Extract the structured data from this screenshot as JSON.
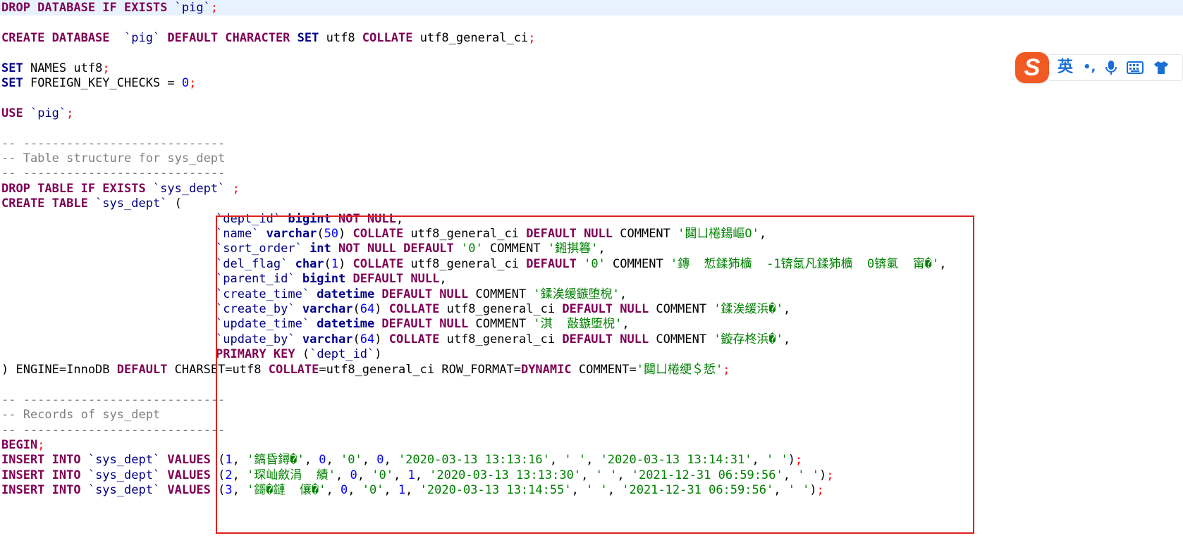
{
  "editor": {
    "lines": [
      {
        "text": "",
        "top": 0,
        "tokens": [
          {
            "t": "DROP DATABASE IF EXISTS ",
            "c": "kw"
          },
          {
            "t": "`pig`",
            "c": "id"
          },
          {
            "t": ";",
            "c": "semi"
          }
        ]
      },
      {
        "tokens": [
          {
            "t": "CREATE DATABASE  ",
            "c": "kw"
          },
          {
            "t": "`pig`",
            "c": "id"
          },
          {
            "t": " DEFAULT CHARACTER ",
            "c": "kw"
          },
          {
            "t": "SET",
            "c": "kw2"
          },
          {
            "t": " utf8 ",
            "c": "plain"
          },
          {
            "t": "COLLATE",
            "c": "kw"
          },
          {
            "t": " utf8_general_ci",
            "c": "plain"
          },
          {
            "t": ";",
            "c": "semi"
          }
        ]
      },
      {
        "tokens": [
          {
            "t": "SET",
            "c": "kw2"
          },
          {
            "t": " NAMES utf8",
            "c": "plain"
          },
          {
            "t": ";",
            "c": "semi"
          }
        ]
      },
      {
        "tokens": [
          {
            "t": "SET",
            "c": "kw2"
          },
          {
            "t": " FOREIGN_KEY_CHECKS = ",
            "c": "plain"
          },
          {
            "t": "0",
            "c": "num"
          },
          {
            "t": ";",
            "c": "semi"
          }
        ]
      },
      {
        "tokens": [
          {
            "t": "USE ",
            "c": "kw"
          },
          {
            "t": "`pig`",
            "c": "id"
          },
          {
            "t": ";",
            "c": "semi"
          }
        ]
      },
      {
        "tokens": [
          {
            "t": "-- ----------------------------",
            "c": "cmt"
          }
        ]
      },
      {
        "tokens": [
          {
            "t": "-- Table structure for sys_dept",
            "c": "cmt"
          }
        ]
      },
      {
        "tokens": [
          {
            "t": "-- ----------------------------",
            "c": "cmt"
          }
        ]
      },
      {
        "tokens": [
          {
            "t": "DROP TABLE IF EXISTS ",
            "c": "kw"
          },
          {
            "t": "`sys_dept`",
            "c": "id"
          },
          {
            "t": " ;",
            "c": "semi"
          }
        ]
      },
      {
        "tokens": [
          {
            "t": "CREATE TABLE ",
            "c": "kw"
          },
          {
            "t": "`sys_dept`",
            "c": "id"
          },
          {
            "t": " (",
            "c": "plain"
          }
        ]
      },
      {
        "tokens": [
          {
            "t": "`dept_id`",
            "c": "id"
          },
          {
            "t": " bigint ",
            "c": "kw2"
          },
          {
            "t": "NOT NULL",
            "c": "kw"
          },
          {
            "t": ",",
            "c": "plain"
          }
        ]
      },
      {
        "tokens": [
          {
            "t": "`name`",
            "c": "id"
          },
          {
            "t": " varchar",
            "c": "kw2"
          },
          {
            "t": "(",
            "c": "plain"
          },
          {
            "t": "50",
            "c": "num"
          },
          {
            "t": ") ",
            "c": "plain"
          },
          {
            "t": "COLLATE",
            "c": "kw"
          },
          {
            "t": " utf8_general_ci ",
            "c": "plain"
          },
          {
            "t": "DEFAULT NULL",
            "c": "kw"
          },
          {
            "t": " COMMENT ",
            "c": "plain"
          },
          {
            "t": "'閮ㄩ棬鍚嶇О'",
            "c": "str"
          },
          {
            "t": ",",
            "c": "plain"
          }
        ]
      },
      {
        "tokens": [
          {
            "t": "`sort_order`",
            "c": "id"
          },
          {
            "t": " int ",
            "c": "kw2"
          },
          {
            "t": "NOT NULL DEFAULT ",
            "c": "kw"
          },
          {
            "t": "'0'",
            "c": "str"
          },
          {
            "t": " COMMENT ",
            "c": "plain"
          },
          {
            "t": "'鎺掑簭'",
            "c": "str"
          },
          {
            "t": ",",
            "c": "plain"
          }
        ]
      },
      {
        "tokens": [
          {
            "t": "`del_flag`",
            "c": "id"
          },
          {
            "t": " char",
            "c": "kw2"
          },
          {
            "t": "(",
            "c": "plain"
          },
          {
            "t": "1",
            "c": "num"
          },
          {
            "t": ") ",
            "c": "plain"
          },
          {
            "t": "COLLATE",
            "c": "kw"
          },
          {
            "t": " utf8_general_ci ",
            "c": "plain"
          },
          {
            "t": "DEFAULT ",
            "c": "kw"
          },
          {
            "t": "'0'",
            "c": "str"
          },
          {
            "t": " COMMENT ",
            "c": "plain"
          },
          {
            "t": "'鏄  惁鍒犻櫎  -1锛氬凡鍒犻櫎  0锛氭  甯�'",
            "c": "str"
          },
          {
            "t": ",",
            "c": "plain"
          }
        ]
      },
      {
        "tokens": [
          {
            "t": "`parent_id`",
            "c": "id"
          },
          {
            "t": " bigint ",
            "c": "kw2"
          },
          {
            "t": "DEFAULT NULL",
            "c": "kw"
          },
          {
            "t": ",",
            "c": "plain"
          }
        ]
      },
      {
        "tokens": [
          {
            "t": "`create_time`",
            "c": "id"
          },
          {
            "t": " datetime ",
            "c": "kw2"
          },
          {
            "t": "DEFAULT NULL",
            "c": "kw"
          },
          {
            "t": " COMMENT ",
            "c": "plain"
          },
          {
            "t": "'鍒涘缓鏃堕棿'",
            "c": "str"
          },
          {
            "t": ",",
            "c": "plain"
          }
        ]
      },
      {
        "tokens": [
          {
            "t": "`create_by`",
            "c": "id"
          },
          {
            "t": " varchar",
            "c": "kw2"
          },
          {
            "t": "(",
            "c": "plain"
          },
          {
            "t": "64",
            "c": "num"
          },
          {
            "t": ") ",
            "c": "plain"
          },
          {
            "t": "COLLATE",
            "c": "kw"
          },
          {
            "t": " utf8_general_ci ",
            "c": "plain"
          },
          {
            "t": "DEFAULT NULL",
            "c": "kw"
          },
          {
            "t": " COMMENT ",
            "c": "plain"
          },
          {
            "t": "'鍒涘缓浜�'",
            "c": "str"
          },
          {
            "t": ",",
            "c": "plain"
          }
        ]
      },
      {
        "tokens": [
          {
            "t": "`update_time`",
            "c": "id"
          },
          {
            "t": " datetime ",
            "c": "kw2"
          },
          {
            "t": "DEFAULT NULL",
            "c": "kw"
          },
          {
            "t": " COMMENT ",
            "c": "plain"
          },
          {
            "t": "'淇  敼鏃堕棿'",
            "c": "str"
          },
          {
            "t": ",",
            "c": "plain"
          }
        ]
      },
      {
        "tokens": [
          {
            "t": "`update_by`",
            "c": "id"
          },
          {
            "t": " varchar",
            "c": "kw2"
          },
          {
            "t": "(",
            "c": "plain"
          },
          {
            "t": "64",
            "c": "num"
          },
          {
            "t": ") ",
            "c": "plain"
          },
          {
            "t": "COLLATE",
            "c": "kw"
          },
          {
            "t": " utf8_general_ci ",
            "c": "plain"
          },
          {
            "t": "DEFAULT NULL",
            "c": "kw"
          },
          {
            "t": " COMMENT ",
            "c": "plain"
          },
          {
            "t": "'鏇存柊浜�'",
            "c": "str"
          },
          {
            "t": ",",
            "c": "plain"
          }
        ]
      },
      {
        "tokens": [
          {
            "t": "PRIMARY KEY",
            "c": "kw"
          },
          {
            "t": " (",
            "c": "plain"
          },
          {
            "t": "`dept_id`",
            "c": "id"
          },
          {
            "t": ")",
            "c": "plain"
          }
        ]
      },
      {
        "tokens": [
          {
            "t": ") ENGINE=InnoDB ",
            "c": "plain"
          },
          {
            "t": "DEFAULT",
            "c": "kw"
          },
          {
            "t": " CHARSET=utf8 ",
            "c": "plain"
          },
          {
            "t": "COLLATE",
            "c": "kw"
          },
          {
            "t": "=utf8_general_ci ROW_FORMAT=",
            "c": "plain"
          },
          {
            "t": "DYNAMIC",
            "c": "kw"
          },
          {
            "t": " COMMENT=",
            "c": "plain"
          },
          {
            "t": "'閮ㄩ棬绠＄悊'",
            "c": "str"
          },
          {
            "t": ";",
            "c": "semi"
          }
        ]
      },
      {
        "tokens": [
          {
            "t": "-- ----------------------------",
            "c": "cmt"
          }
        ]
      },
      {
        "tokens": [
          {
            "t": "-- Records of sys_dept",
            "c": "cmt"
          }
        ]
      },
      {
        "tokens": [
          {
            "t": "-- ----------------------------",
            "c": "cmt"
          }
        ]
      },
      {
        "tokens": [
          {
            "t": "BEGIN",
            "c": "kw"
          },
          {
            "t": ";",
            "c": "semi"
          }
        ]
      },
      {
        "tokens": [
          {
            "t": "INSERT INTO ",
            "c": "kw"
          },
          {
            "t": "`sys_dept`",
            "c": "id"
          },
          {
            "t": " VALUES ",
            "c": "kw"
          },
          {
            "t": "(",
            "c": "plain"
          },
          {
            "t": "1",
            "c": "num"
          },
          {
            "t": ", ",
            "c": "plain"
          },
          {
            "t": "'鎬昏鐞�'",
            "c": "str"
          },
          {
            "t": ", ",
            "c": "plain"
          },
          {
            "t": "0",
            "c": "num"
          },
          {
            "t": ", ",
            "c": "plain"
          },
          {
            "t": "'0'",
            "c": "str"
          },
          {
            "t": ", ",
            "c": "plain"
          },
          {
            "t": "0",
            "c": "num"
          },
          {
            "t": ", ",
            "c": "plain"
          },
          {
            "t": "'2020-03-13 13:13:16'",
            "c": "str"
          },
          {
            "t": ", ",
            "c": "plain"
          },
          {
            "t": "' '",
            "c": "str"
          },
          {
            "t": ", ",
            "c": "plain"
          },
          {
            "t": "'2020-03-13 13:14:31'",
            "c": "str"
          },
          {
            "t": ", ",
            "c": "plain"
          },
          {
            "t": "' '",
            "c": "str"
          },
          {
            "t": ")",
            "c": "plain"
          },
          {
            "t": ";",
            "c": "semi"
          }
        ]
      },
      {
        "tokens": [
          {
            "t": "INSERT INTO ",
            "c": "kw"
          },
          {
            "t": "`sys_dept`",
            "c": "id"
          },
          {
            "t": " VALUES ",
            "c": "kw"
          },
          {
            "t": "(",
            "c": "plain"
          },
          {
            "t": "2",
            "c": "num"
          },
          {
            "t": ", ",
            "c": "plain"
          },
          {
            "t": "'琛屾斂涓  績'",
            "c": "str"
          },
          {
            "t": ", ",
            "c": "plain"
          },
          {
            "t": "0",
            "c": "num"
          },
          {
            "t": ", ",
            "c": "plain"
          },
          {
            "t": "'0'",
            "c": "str"
          },
          {
            "t": ", ",
            "c": "plain"
          },
          {
            "t": "1",
            "c": "num"
          },
          {
            "t": ", ",
            "c": "plain"
          },
          {
            "t": "'2020-03-13 13:13:30'",
            "c": "str"
          },
          {
            "t": ", ",
            "c": "plain"
          },
          {
            "t": "' '",
            "c": "str"
          },
          {
            "t": ", ",
            "c": "plain"
          },
          {
            "t": "'2021-12-31 06:59:56'",
            "c": "str"
          },
          {
            "t": ", ",
            "c": "plain"
          },
          {
            "t": "' '",
            "c": "str"
          },
          {
            "t": ")",
            "c": "plain"
          },
          {
            "t": ";",
            "c": "semi"
          }
        ]
      },
      {
        "tokens": [
          {
            "t": "INSERT INTO ",
            "c": "kw"
          },
          {
            "t": "`sys_dept`",
            "c": "id"
          },
          {
            "t": " VALUES ",
            "c": "kw"
          },
          {
            "t": "(",
            "c": "plain"
          },
          {
            "t": "3",
            "c": "num"
          },
          {
            "t": ", ",
            "c": "plain"
          },
          {
            "t": "'鎶�鏈  儴�'",
            "c": "str"
          },
          {
            "t": ", ",
            "c": "plain"
          },
          {
            "t": "0",
            "c": "num"
          },
          {
            "t": ", ",
            "c": "plain"
          },
          {
            "t": "'0'",
            "c": "str"
          },
          {
            "t": ", ",
            "c": "plain"
          },
          {
            "t": "1",
            "c": "num"
          },
          {
            "t": ", ",
            "c": "plain"
          },
          {
            "t": "'2020-03-13 13:14:55'",
            "c": "str"
          },
          {
            "t": ", ",
            "c": "plain"
          },
          {
            "t": "' '",
            "c": "str"
          },
          {
            "t": ", ",
            "c": "plain"
          },
          {
            "t": "'2021-12-31 06:59:56'",
            "c": "str"
          },
          {
            "t": ", ",
            "c": "plain"
          },
          {
            "t": "' '",
            "c": "str"
          },
          {
            "t": ")",
            "c": "plain"
          },
          {
            "t": ";",
            "c": "semi"
          }
        ]
      }
    ]
  },
  "ime": {
    "logo": "S",
    "lang": "英",
    "punct": "•,",
    "icons": [
      "microphone-icon",
      "keyboard-icon",
      "skin-shirt-icon"
    ]
  },
  "colors": {
    "keyword": "#7f0055",
    "type": "#00008b",
    "string": "#008000",
    "number": "#0000ff",
    "comment": "#808080",
    "semicolon": "#ff0000",
    "highlight_border": "#e02020",
    "ime_accent": "#1a6fd6",
    "ime_logo": "#f25a24"
  }
}
